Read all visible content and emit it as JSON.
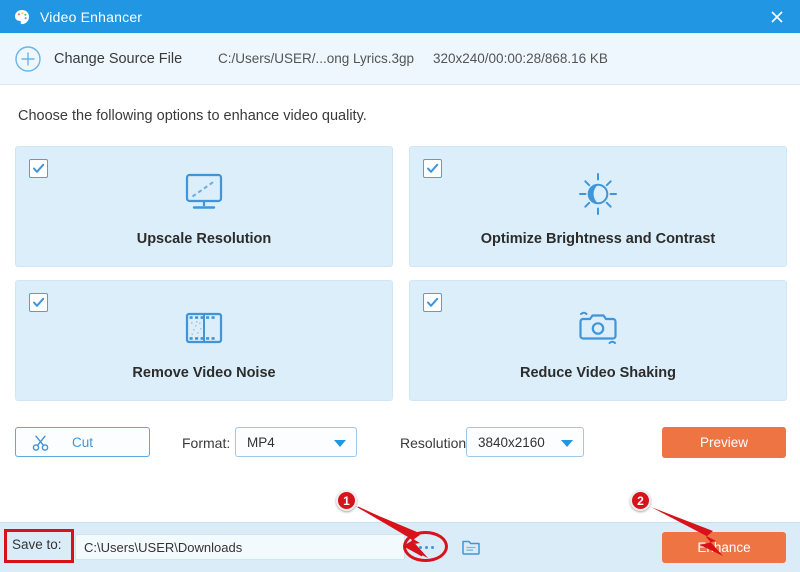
{
  "window": {
    "title": "Video Enhancer",
    "app_icon": "palette-icon",
    "close_icon": "close-icon",
    "titlebar_color": "#2196e3"
  },
  "source_bar": {
    "add_icon": "plus-circle-icon",
    "change_source_label": "Change Source File",
    "file_path": "C:/Users/USER/...ong Lyrics.3gp",
    "file_meta": "320x240/00:00:28/868.16 KB"
  },
  "instruction": "Choose the following options to enhance video quality.",
  "options": [
    {
      "label": "Upscale Resolution",
      "icon": "monitor-upscale-icon",
      "checked": true
    },
    {
      "label": "Optimize Brightness and Contrast",
      "icon": "sun-contrast-icon",
      "checked": true
    },
    {
      "label": "Remove Video Noise",
      "icon": "film-strip-noise-icon",
      "checked": true
    },
    {
      "label": "Reduce Video Shaking",
      "icon": "camera-shake-icon",
      "checked": true
    }
  ],
  "controls": {
    "cut_label": "Cut",
    "cut_icon": "scissors-icon",
    "format_label": "Format:",
    "format_value": "MP4",
    "resolution_label": "Resolution:",
    "resolution_value": "3840x2160",
    "preview_label": "Preview",
    "accent_orange": "#ef7444"
  },
  "bottom_bar": {
    "save_to_label": "Save to:",
    "save_path": "C:\\Users\\USER\\Downloads",
    "browse_icon": "ellipsis-icon",
    "open_folder_icon": "folder-icon",
    "enhance_label": "Enhance"
  },
  "annotations": {
    "badge_1": "1",
    "badge_2": "2",
    "highlight_color": "#d8121a"
  }
}
